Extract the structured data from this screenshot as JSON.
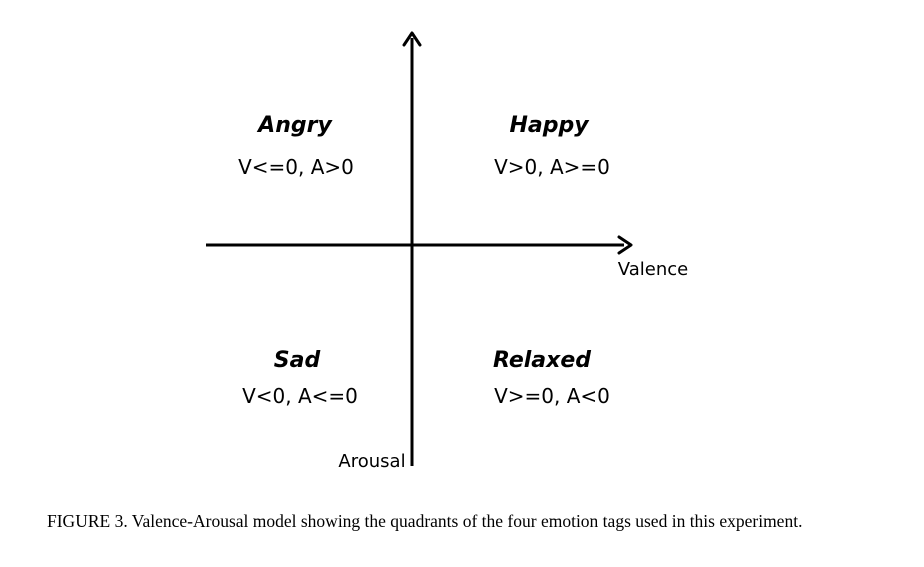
{
  "diagram": {
    "axes": {
      "x_label": "Valence",
      "y_label": "Arousal"
    },
    "quadrants": [
      {
        "id": "top-left",
        "name": "Angry",
        "rule": "V<=0, A>0"
      },
      {
        "id": "top-right",
        "name": "Happy",
        "rule": "V>0, A>=0"
      },
      {
        "id": "bottom-left",
        "name": "Sad",
        "rule": "V<0, A<=0"
      },
      {
        "id": "bottom-right",
        "name": "Relaxed",
        "rule": "V>=0, A<0"
      }
    ]
  },
  "caption": {
    "label": "FIGURE 3.",
    "text": "Valence-Arousal model showing the quadrants of the four emotion tags used in this experiment."
  }
}
